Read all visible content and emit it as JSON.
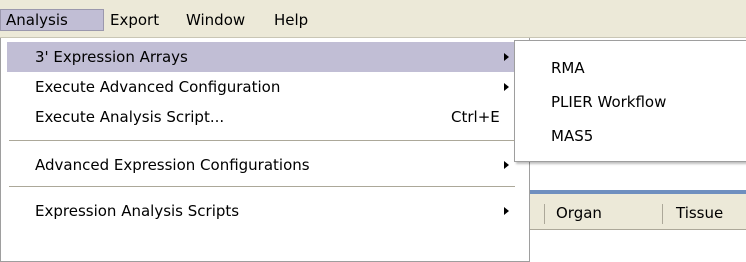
{
  "menubar": {
    "items": [
      {
        "label": "Analysis"
      },
      {
        "label": "Export"
      },
      {
        "label": "Window"
      },
      {
        "label": "Help"
      }
    ]
  },
  "dropdown": {
    "items": [
      {
        "label": "3' Expression Arrays",
        "shortcut": "",
        "submenu": true,
        "highlighted": true
      },
      {
        "label": "Execute Advanced Configuration",
        "shortcut": "",
        "submenu": true
      },
      {
        "label": "Execute Analysis Script...",
        "shortcut": "Ctrl+E",
        "submenu": false
      },
      {
        "label": "Advanced Expression Configurations",
        "shortcut": "",
        "submenu": true
      },
      {
        "label": "Expression Analysis Scripts",
        "shortcut": "",
        "submenu": true
      }
    ]
  },
  "submenu": {
    "items": [
      {
        "label": "RMA"
      },
      {
        "label": "PLIER Workflow"
      },
      {
        "label": "MAS5"
      }
    ]
  },
  "grid": {
    "columns": [
      {
        "label": "Organ"
      },
      {
        "label": "Tissue"
      }
    ]
  }
}
